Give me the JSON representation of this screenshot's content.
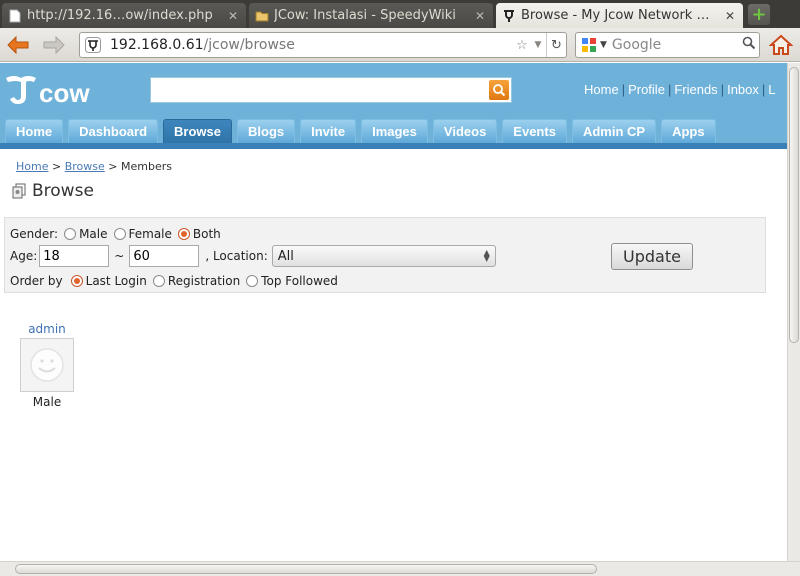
{
  "browser": {
    "tabs": [
      {
        "title": "http://192.16…ow/index.php",
        "favicon": "page-icon",
        "active": false
      },
      {
        "title": "JCow: Instalasi - SpeedyWiki",
        "favicon": "folder-icon",
        "active": false
      },
      {
        "title": "Browse - My Jcow Network …",
        "favicon": "jcow-icon",
        "active": true
      }
    ],
    "url_host": "192.168.0.61",
    "url_path": "/jcow/browse",
    "search_placeholder": "Google"
  },
  "site": {
    "logo_text": "cow",
    "header_search_value": "",
    "top_links": [
      "Home",
      "Profile",
      "Friends",
      "Inbox",
      "L"
    ],
    "menu": [
      "Home",
      "Dashboard",
      "Browse",
      "Blogs",
      "Invite",
      "Images",
      "Videos",
      "Events",
      "Admin CP",
      "Apps"
    ],
    "menu_active": "Browse",
    "colors": {
      "header": "#6eb1d9",
      "menu_active": "#2f74a8",
      "accent": "#e2642d",
      "link": "#3f72b5"
    }
  },
  "breadcrumb": {
    "home": "Home",
    "browse": "Browse",
    "current": "Members",
    "separator": ">"
  },
  "page_title": "Browse",
  "filter": {
    "gender_label": "Gender:",
    "gender_options": [
      "Male",
      "Female",
      "Both"
    ],
    "gender_selected": "Both",
    "age_label": "Age:",
    "age_min": "18",
    "age_tilde": "~",
    "age_max": "60",
    "location_label": ", Location:",
    "location_value": "All",
    "order_label": "Order by",
    "order_options": [
      "Last Login",
      "Registration",
      "Top Followed"
    ],
    "order_selected": "Last Login",
    "update_label": "Update"
  },
  "members": [
    {
      "name": "admin",
      "gender": "Male",
      "avatar": "smiley-avatar-icon"
    }
  ]
}
